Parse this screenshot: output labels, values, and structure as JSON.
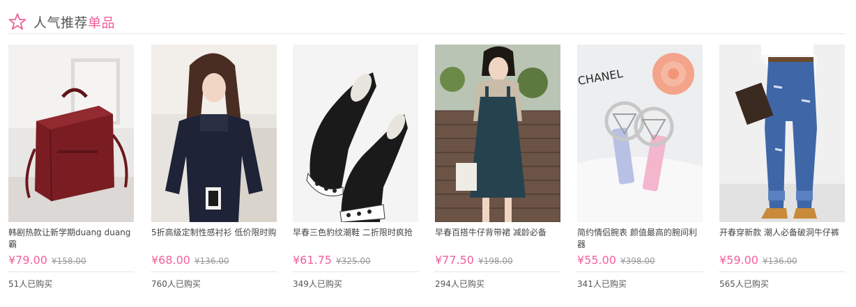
{
  "header": {
    "title_prefix": "人气推荐",
    "title_accent": "单品",
    "icon": "star-outline-icon",
    "accent_color": "#f0609a"
  },
  "products": [
    {
      "name": "韩剧热款让新学期duang duang 霸",
      "price": "¥79.00",
      "original_price": "¥158.00",
      "sold": "51人已购买",
      "image": "burgundy-backpack"
    },
    {
      "name": "5折高级定制性感衬衫 低价限时购",
      "price": "¥68.00",
      "original_price": "¥136.00",
      "sold": "760人已购买",
      "image": "woman-navy-blouse"
    },
    {
      "name": "早春三色豹纹潮鞋 二折限时疯抢",
      "price": "¥61.75",
      "original_price": "¥325.00",
      "sold": "349人已购买",
      "image": "black-leopard-slip-on-shoes"
    },
    {
      "name": "早春百搭牛仔背带裙 减龄必备",
      "price": "¥77.50",
      "original_price": "¥198.00",
      "sold": "294人已购买",
      "image": "denim-overall-dress"
    },
    {
      "name": "简约情侣腕表 颜值最高的腕间利器",
      "price": "¥55.00",
      "original_price": "¥398.00",
      "sold": "341人已购买",
      "image": "couple-watches-chanel"
    },
    {
      "name": "开春穿新款 潮人必备破洞牛仔裤",
      "price": "¥59.00",
      "original_price": "¥136.00",
      "sold": "565人已购买",
      "image": "ripped-jeans"
    }
  ],
  "image_text": {
    "chanel_label": "CHANEL"
  }
}
